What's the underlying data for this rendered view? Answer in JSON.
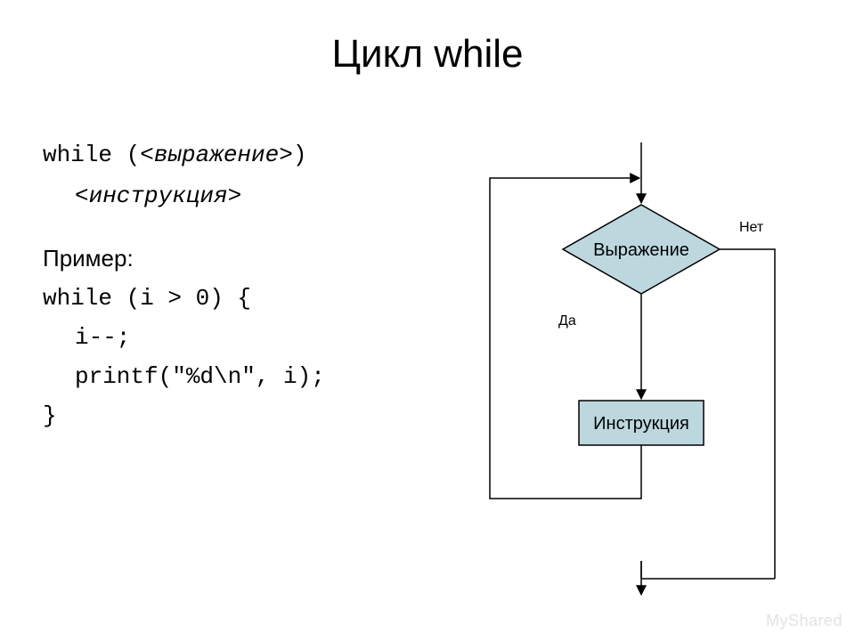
{
  "title": "Цикл while",
  "syntax": {
    "line1_pre": "while (",
    "line1_expr": "<выражение>",
    "line1_post": ")",
    "line2_instr": "<инструкция>"
  },
  "example": {
    "heading": "Пример:",
    "l1": "while (i > 0) {",
    "l2": "i--;",
    "l3": "printf(\"%d\\n\", i);",
    "l4": "}"
  },
  "flow": {
    "condition": "Выражение",
    "body": "Инструкция",
    "yes": "Да",
    "no": "Нет"
  },
  "colors": {
    "node_fill": "#bdd7de",
    "stroke": "#000000"
  },
  "watermark": "MyShared"
}
